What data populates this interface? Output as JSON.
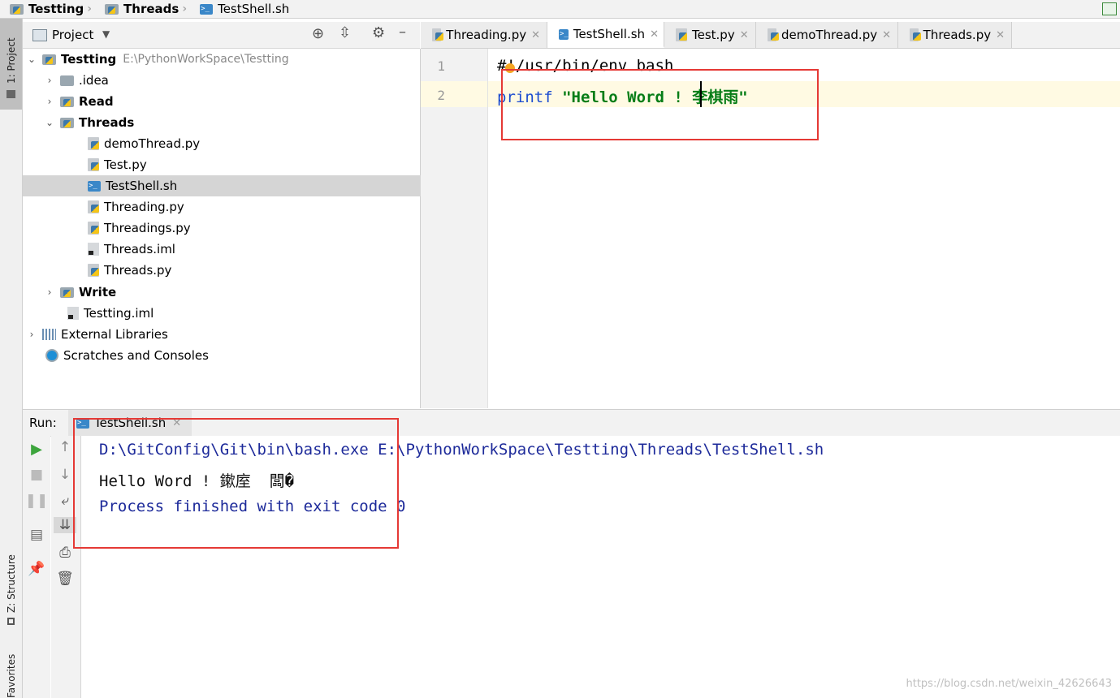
{
  "breadcrumb": {
    "items": [
      "Testting",
      "Threads",
      "TestShell.sh"
    ]
  },
  "left_strip": {
    "project_tab": "1: Project",
    "structure_tab": "Z: Structure",
    "favorites_tab": "Favorites"
  },
  "project_panel": {
    "title": "Project",
    "root": {
      "label": "Testting",
      "path": "E:\\PythonWorkSpace\\Testting"
    },
    "items": [
      {
        "label": ".idea"
      },
      {
        "label": "Read"
      },
      {
        "label": "Threads"
      },
      {
        "label": "demoThread.py"
      },
      {
        "label": "Test.py"
      },
      {
        "label": "TestShell.sh"
      },
      {
        "label": "Threading.py"
      },
      {
        "label": "Threadings.py"
      },
      {
        "label": "Threads.iml"
      },
      {
        "label": "Threads.py"
      },
      {
        "label": "Write"
      },
      {
        "label": "Testting.iml"
      },
      {
        "label": "External Libraries"
      },
      {
        "label": "Scratches and Consoles"
      }
    ]
  },
  "tabs": [
    {
      "label": "Threading.py"
    },
    {
      "label": "TestShell.sh"
    },
    {
      "label": "Test.py"
    },
    {
      "label": "demoThread.py"
    },
    {
      "label": "Threads.py"
    }
  ],
  "editor": {
    "lines": [
      {
        "num": "1",
        "shebang": "#!/usr/bin/env bash"
      },
      {
        "num": "2",
        "keyword": "printf",
        "string": "\"Hello Word ! 李棋雨\""
      }
    ]
  },
  "run": {
    "label": "Run:",
    "tab": "TestShell.sh",
    "console": {
      "command": "D:\\GitConfig\\Git\\bin\\bash.exe E:\\PythonWorkSpace\\Testting\\Threads\\TestShell.sh",
      "output": "Hello Word ! 鏉庢  闆�",
      "finished": "Process finished with exit code 0"
    }
  },
  "watermark": "https://blog.csdn.net/weixin_42626643",
  "colors": {
    "highlight_box": "#e53935",
    "keyword": "#1a4bd0",
    "string": "#067d17",
    "console_system": "#1d2a9a"
  }
}
